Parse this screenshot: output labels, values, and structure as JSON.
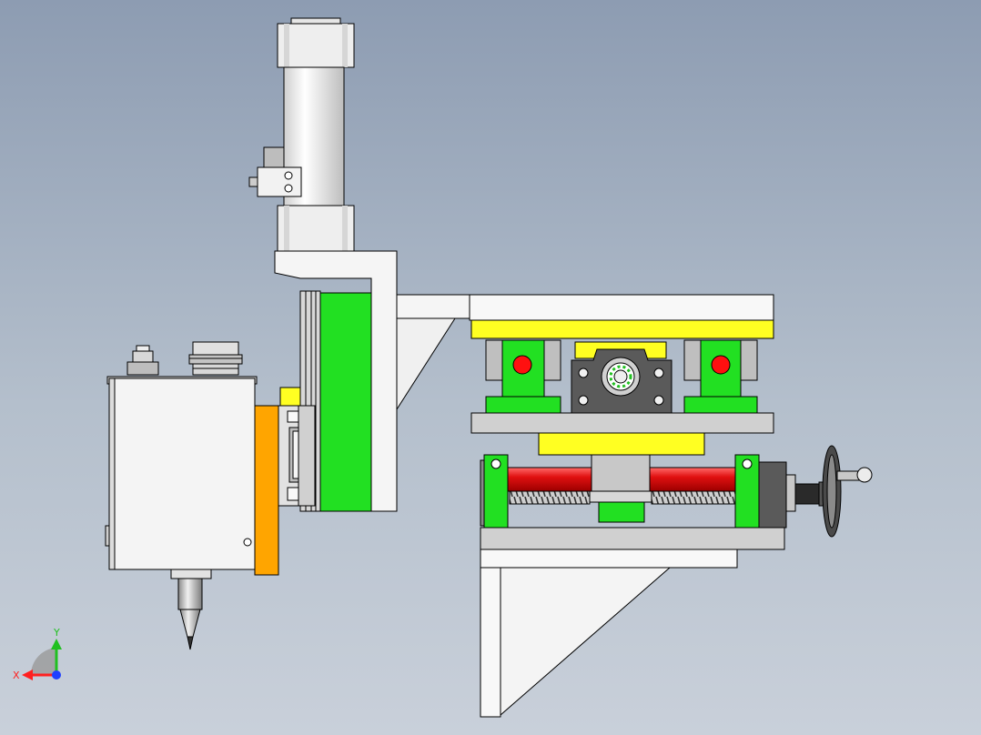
{
  "view": {
    "background_top": "#8d9cb2",
    "background_bottom": "#c9d0da"
  },
  "colors": {
    "green": "#22e022",
    "yellow": "#ffff22",
    "orange": "#ffa500",
    "red_rod": "#e01010",
    "red_knob": "#ff1010",
    "white_part": "#f4f4f4",
    "grey_part": "#c8c8c8",
    "dark_part": "#5a5a5a",
    "outline": "#000000"
  },
  "triad": {
    "x_label": "X",
    "y_label": "Y",
    "x_color": "#ff2020",
    "y_color": "#20c020",
    "z_color": "#2040ff"
  },
  "icons": [
    "coordinate-triad-icon",
    "handwheel-icon",
    "bearing-icon"
  ]
}
